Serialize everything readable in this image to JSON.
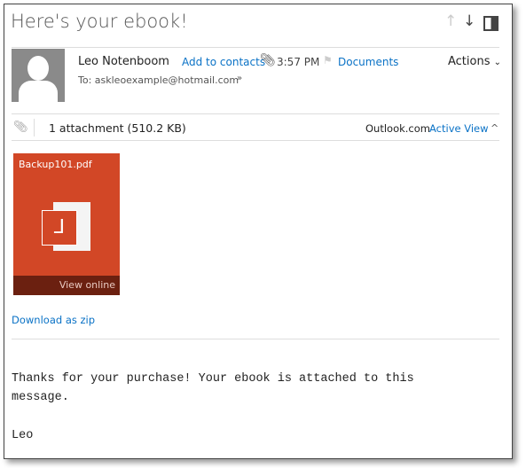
{
  "subject": "Here's your ebook!",
  "sender": {
    "name": "Leo Notenboom",
    "add_contacts": "Add to contacts",
    "time": "3:57 PM",
    "category": "Documents",
    "to": "To: askleoexample@hotmail.com",
    "actions": "Actions"
  },
  "attachments": {
    "summary": "1 attachment (510.2 KB)",
    "provider": "Outlook.com",
    "active_view": "Active View",
    "file_name": "Backup101.pdf",
    "view_online": "View online",
    "download_zip": "Download as zip",
    "tile_color": "#d24726"
  },
  "body": {
    "line1": "Thanks for your purchase! Your ebook is attached to this",
    "line2": "message.",
    "signature": "Leo"
  }
}
